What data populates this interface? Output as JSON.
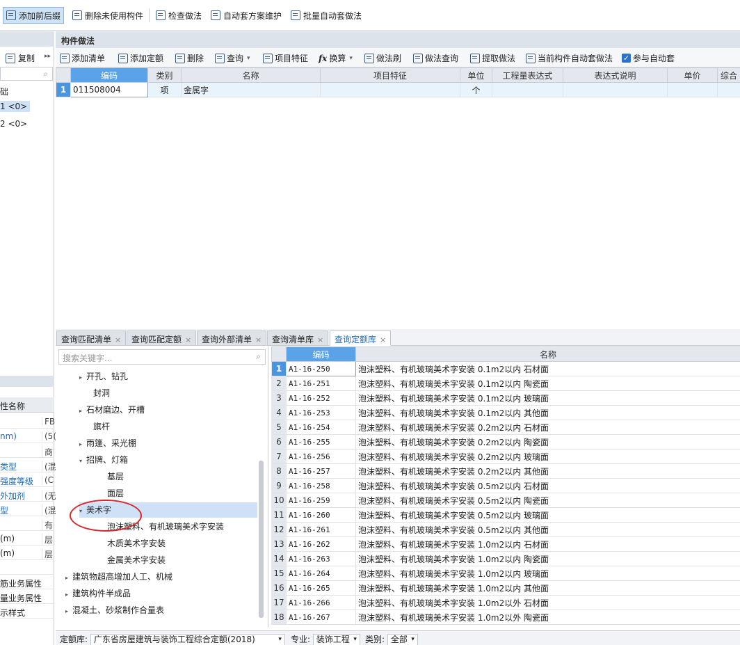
{
  "top_toolbar": {
    "items": [
      "添加前后缀",
      "删除未使用构件",
      "检查做法",
      "自动套方案维护",
      "批量自动套做法"
    ]
  },
  "left_panel": {
    "copy_label": "复制",
    "more": "▸▸",
    "tree": [
      "础",
      "1 <0>",
      "2 <0>"
    ],
    "prop_header": "性名称",
    "props": [
      {
        "name": "",
        "value": "FB"
      },
      {
        "name": "nm)",
        "value": "(5("
      },
      {
        "name": "",
        "value": "商"
      },
      {
        "name": "类型",
        "value": "(混"
      },
      {
        "name": "强度等级",
        "value": "(C"
      },
      {
        "name": "外加剂",
        "value": "(无"
      },
      {
        "name": "型",
        "value": "(混"
      },
      {
        "name": "",
        "value": "有"
      },
      {
        "name": "(m)",
        "value": "层"
      },
      {
        "name": "(m)",
        "value": "层"
      },
      {
        "name": "",
        "value": ""
      },
      {
        "name": "筋业务属性",
        "value": ""
      },
      {
        "name": "量业务属性",
        "value": ""
      },
      {
        "name": "示样式",
        "value": ""
      }
    ]
  },
  "method_panel": {
    "title": "构件做法",
    "toolbar": [
      "添加清单",
      "添加定额",
      "删除",
      "查询",
      "项目特征",
      "换算",
      "做法刷",
      "做法查询",
      "提取做法",
      "当前构件自动套做法",
      "参与自动套"
    ],
    "fx_symbol": "fx",
    "columns": [
      "编码",
      "类别",
      "名称",
      "项目特征",
      "单位",
      "工程量表达式",
      "表达式说明",
      "单价",
      "综合"
    ],
    "rows": [
      {
        "num": "1",
        "code": "011508004",
        "type": "项",
        "name": "金属字",
        "feature": "",
        "unit": "个",
        "expr": "",
        "expr_desc": "",
        "price": "",
        "total": ""
      }
    ]
  },
  "tabs": [
    {
      "label": "查询匹配清单",
      "close": "×"
    },
    {
      "label": "查询匹配定额",
      "close": "×"
    },
    {
      "label": "查询外部清单",
      "close": "×"
    },
    {
      "label": "查询清单库",
      "close": "×"
    },
    {
      "label": "查询定额库",
      "close": "×"
    }
  ],
  "tree": {
    "search_placeholder": "搜索关键字...",
    "nodes": [
      {
        "label": "开孔、钻孔",
        "arrow": "▸"
      },
      {
        "label": "封洞",
        "arrow": ""
      },
      {
        "label": "石材磨边、开槽",
        "arrow": "▸"
      },
      {
        "label": "旗杆",
        "arrow": ""
      },
      {
        "label": "雨篷、采光棚",
        "arrow": "▸"
      },
      {
        "label": "招牌、灯箱",
        "arrow": "▾"
      },
      {
        "label": "基层",
        "arrow": ""
      },
      {
        "label": "面层",
        "arrow": ""
      },
      {
        "label": "美术字",
        "arrow": "▾"
      },
      {
        "label": "泡沫塑料、有机玻璃美术字安装",
        "arrow": ""
      },
      {
        "label": "木质美术字安装",
        "arrow": ""
      },
      {
        "label": "金属美术字安装",
        "arrow": ""
      },
      {
        "label": "建筑物超高增加人工、机械",
        "arrow": "▸"
      },
      {
        "label": "建筑构件半成品",
        "arrow": "▸"
      },
      {
        "label": "混凝土、砂浆制作合量表",
        "arrow": "▸"
      }
    ]
  },
  "result": {
    "columns": [
      "编码",
      "名称"
    ],
    "rows": [
      {
        "num": "1",
        "code": "A1-16-250",
        "name": "泡沫塑料、有机玻璃美术字安装 0.1m2以内 石材面"
      },
      {
        "num": "2",
        "code": "A1-16-251",
        "name": "泡沫塑料、有机玻璃美术字安装 0.1m2以内 陶瓷面"
      },
      {
        "num": "3",
        "code": "A1-16-252",
        "name": "泡沫塑料、有机玻璃美术字安装 0.1m2以内 玻璃面"
      },
      {
        "num": "4",
        "code": "A1-16-253",
        "name": "泡沫塑料、有机玻璃美术字安装 0.1m2以内 其他面"
      },
      {
        "num": "5",
        "code": "A1-16-254",
        "name": "泡沫塑料、有机玻璃美术字安装 0.2m2以内 石材面"
      },
      {
        "num": "6",
        "code": "A1-16-255",
        "name": "泡沫塑料、有机玻璃美术字安装 0.2m2以内 陶瓷面"
      },
      {
        "num": "7",
        "code": "A1-16-256",
        "name": "泡沫塑料、有机玻璃美术字安装 0.2m2以内 玻璃面"
      },
      {
        "num": "8",
        "code": "A1-16-257",
        "name": "泡沫塑料、有机玻璃美术字安装 0.2m2以内 其他面"
      },
      {
        "num": "9",
        "code": "A1-16-258",
        "name": "泡沫塑料、有机玻璃美术字安装 0.5m2以内 石材面"
      },
      {
        "num": "10",
        "code": "A1-16-259",
        "name": "泡沫塑料、有机玻璃美术字安装 0.5m2以内 陶瓷面"
      },
      {
        "num": "11",
        "code": "A1-16-260",
        "name": "泡沫塑料、有机玻璃美术字安装 0.5m2以内 玻璃面"
      },
      {
        "num": "12",
        "code": "A1-16-261",
        "name": "泡沫塑料、有机玻璃美术字安装 0.5m2以内 其他面"
      },
      {
        "num": "13",
        "code": "A1-16-262",
        "name": "泡沫塑料、有机玻璃美术字安装 1.0m2以内 石材面"
      },
      {
        "num": "14",
        "code": "A1-16-263",
        "name": "泡沫塑料、有机玻璃美术字安装 1.0m2以内 陶瓷面"
      },
      {
        "num": "15",
        "code": "A1-16-264",
        "name": "泡沫塑料、有机玻璃美术字安装 1.0m2以内 玻璃面"
      },
      {
        "num": "16",
        "code": "A1-16-265",
        "name": "泡沫塑料、有机玻璃美术字安装 1.0m2以内 其他面"
      },
      {
        "num": "17",
        "code": "A1-16-266",
        "name": "泡沫塑料、有机玻璃美术字安装 1.0m2以外 石材面"
      },
      {
        "num": "18",
        "code": "A1-16-267",
        "name": "泡沫塑料、有机玻璃美术字安装 1.0m2以外 陶瓷面"
      }
    ]
  },
  "status": {
    "quota_label": "定额库:",
    "quota_value": "广东省房屋建筑与装饰工程综合定额(2018)",
    "major_label": "专业:",
    "major_value": "装饰工程",
    "category_label": "类别:",
    "category_value": "全部",
    "caret": "▾"
  },
  "colors": {
    "header_bg": "#dde3ea",
    "selected_header": "#5aa3e8",
    "tree_selected": "#cfe1f7",
    "annotation": "#d8262d"
  }
}
